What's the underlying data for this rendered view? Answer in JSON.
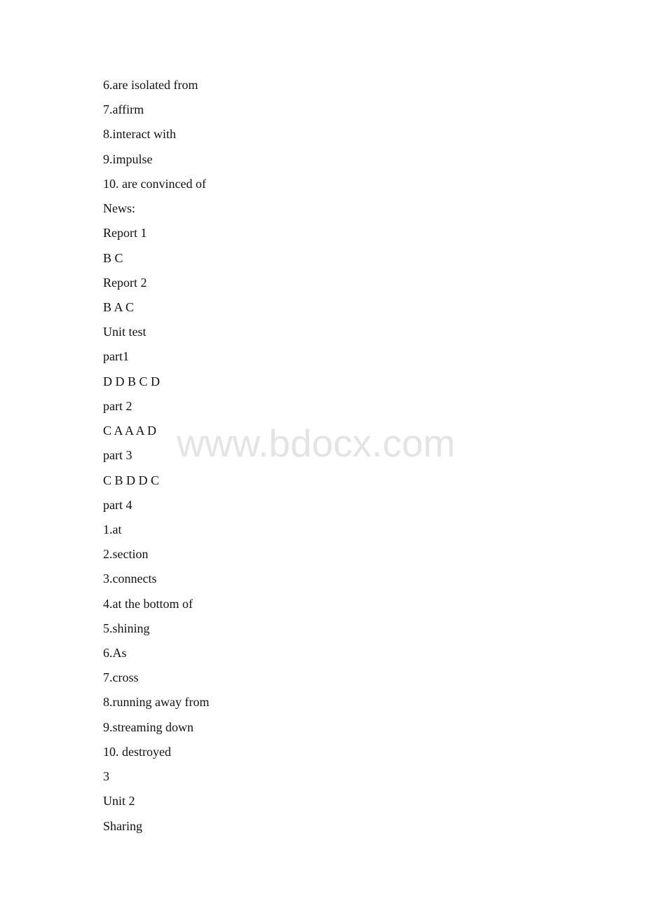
{
  "document": {
    "lines": [
      "6.are isolated from",
      "7.affirm",
      "8.interact with",
      "9.impulse",
      "10. are convinced of",
      "News:",
      "Report 1",
      "B C",
      "Report 2",
      "B A C",
      "Unit test",
      "part1",
      "D D B C D",
      "part 2",
      "C A A A D",
      "part 3",
      "C B D D C",
      "part 4",
      "1.at",
      "2.section",
      "3.connects",
      "4.at the bottom of",
      "5.shining",
      "6.As",
      "7.cross",
      "8.running away from",
      "9.streaming down",
      "10. destroyed",
      "3",
      "Unit 2",
      "Sharing"
    ]
  },
  "watermark": {
    "text": "www.bdocx.com"
  }
}
